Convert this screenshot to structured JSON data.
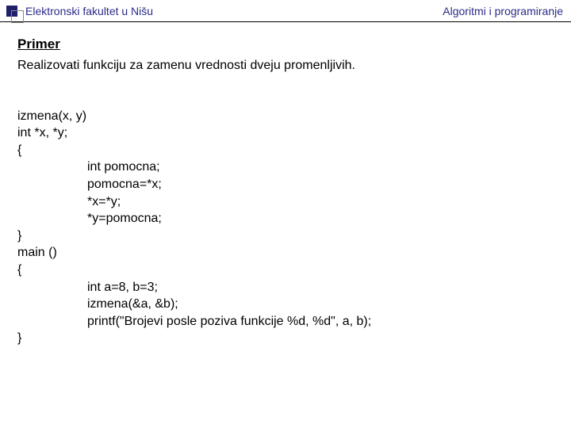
{
  "header": {
    "left": "Elektronski fakultet u Nišu",
    "right": "Algoritmi i programiranje"
  },
  "section_title": "Primer",
  "description": "Realizovati funkciju za zamenu vrednosti dveju promenljivih.",
  "code": {
    "l1": "izmena(x, y)",
    "l2": "int *x, *y;",
    "l3": "{",
    "l4": "int pomocna;",
    "l5": "pomocna=*x;",
    "l6": "*x=*y;",
    "l7": "*y=pomocna;",
    "l8": "}",
    "l9": "main ()",
    "l10": "{",
    "l11": "int a=8, b=3;",
    "l12": "izmena(&a, &b);",
    "l13": "printf(\"Brojevi posle poziva funkcije %d, %d\", a, b);",
    "l14": "}"
  }
}
